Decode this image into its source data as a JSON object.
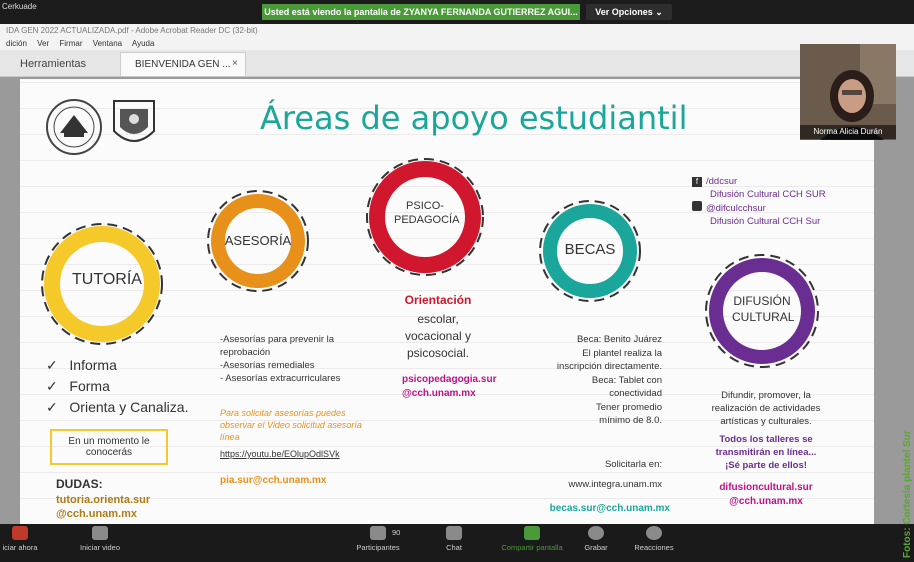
{
  "zoom": {
    "host_label": "Cerkuade",
    "share_banner": "Usted está viendo la pantalla de ZYANYA FERNANDA GUTIERREZ AGUI...",
    "view_options": "Ver Opciones",
    "participants_count": "90",
    "bottom_buttons": [
      "iciar ahora",
      "Iniciar video",
      "Participantes",
      "Chat",
      "Compartir pantalla",
      "Grabar",
      "Reacciones"
    ],
    "webcam_name": "Norma Alicia Durán"
  },
  "acrobat": {
    "title": "IDA GEN 2022 ACTUALIZADA.pdf - Adobe Acrobat Reader DC (32-bit)",
    "menu": [
      "dición",
      "Ver",
      "Firmar",
      "Ventana",
      "Ayuda"
    ],
    "tab_tools": "Herramientas",
    "tab_doc": "BIENVENIDA GEN ...",
    "tab_close": "×"
  },
  "slide": {
    "title": "Áreas de apoyo estudiantil",
    "social": {
      "fb_handle": "/ddcsur",
      "fb_name": "Difusión Cultural CCH SUR",
      "ig_handle": "@difculcchsur",
      "ig_name": "Difusión Cultural CCH Sur"
    },
    "circles": [
      {
        "label": "TUTORÍA",
        "color": "#f6c92b"
      },
      {
        "label": "ASESORÍA",
        "color": "#e8911a"
      },
      {
        "label": "PSICO-PEDAGOCÍA",
        "color": "#d0172d"
      },
      {
        "label": "BECAS",
        "color": "#1aa69a"
      },
      {
        "label": "DIFUSIÓN CULTURAL",
        "color": "#6a2d91"
      }
    ],
    "tutoria": {
      "items": [
        "Informa",
        "Forma",
        "Orienta y Canaliza."
      ],
      "box": "En un momento le conocerás",
      "dudas_label": "DUDAS:",
      "email_1": "tutoria.orienta.sur",
      "email_2": "@cch.unam.mx"
    },
    "asesoria": {
      "lines": [
        "-Asesorías para prevenir la",
        "reprobación",
        "-Asesorías remediales",
        "- Asesorías extracurriculares"
      ],
      "solicitar": "Para solicitar asesorías puedes observar el Video solicitud asesoría línea",
      "link": "https://youtu.be/EOlupOdlSVk",
      "email": "pia.sur@cch.unam.mx"
    },
    "psico": {
      "title": "Orientación",
      "lines": [
        "escolar,",
        "vocacional y",
        "psicosocial."
      ],
      "email_1": "psicopedagogia.sur",
      "email_2": "@cch.unam.mx"
    },
    "becas": {
      "lines": [
        "Beca: Benito Juárez",
        "El plantel realiza la",
        "inscripción directamente.",
        "Beca: Tablet con",
        "conectividad",
        "Tener promedio",
        "mínimo de 8.0."
      ],
      "solicitar": "Solicitarla en:",
      "url": "www.integra.unam.mx",
      "email": "becas.sur@cch.unam.mx"
    },
    "difusion": {
      "lines": [
        "Difundir, promover, la",
        "realización de actividades",
        "artísticas y culturales."
      ],
      "highlight": [
        "Todos los talleres se",
        "transmitirán en línea...",
        "¡Sé parte de ellos!"
      ],
      "email_1": "difusioncultural.sur",
      "email_2": "@cch.unam.mx"
    }
  },
  "watermark": "Fotos: Cortesía plantel Sur",
  "colors": {
    "zoom_green": "#4a9a3a",
    "bar_dark": "#1a1a1a"
  }
}
